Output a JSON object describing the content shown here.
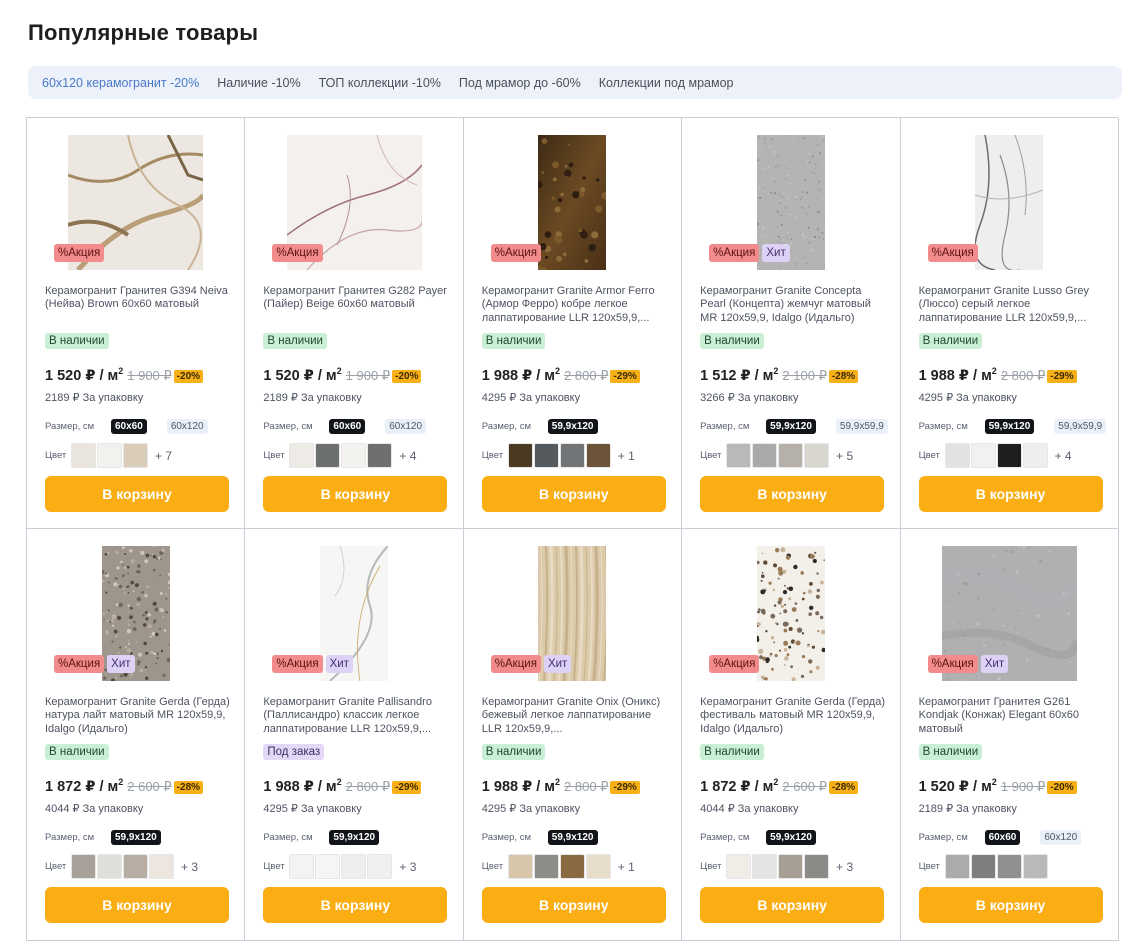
{
  "page": {
    "title": "Популярные товары"
  },
  "filters": [
    {
      "label": "60х120 керамогранит -20%",
      "active": true
    },
    {
      "label": "Наличие -10%",
      "active": false
    },
    {
      "label": "ТОП коллекции -10%",
      "active": false
    },
    {
      "label": "Под мрамор до -60%",
      "active": false
    },
    {
      "label": "Коллекции под мрамор",
      "active": false
    }
  ],
  "labels": {
    "size": "Размер, см",
    "color": "Цвет",
    "cart": "В корзину",
    "sale": "%Акция",
    "hit": "Хит",
    "unit": " ₽ / м",
    "unit_sup": "2"
  },
  "products": [
    {
      "name": "Керамогранит Гранитея G394 Neiva (Нейва) Brown 60x60 матовый",
      "badges": [
        "sale"
      ],
      "availability": "В наличии",
      "availability_type": "in",
      "price": "1 520",
      "old_price": "1 900 ₽",
      "discount": "-20%",
      "pack": "2189 ₽ За упаковку",
      "sizes": [
        "60x60",
        "60x120"
      ],
      "colors": [
        "#e9e4dc",
        "#f2f1ee",
        "#d9cdb8"
      ],
      "more": "+ 7",
      "tile": "marble-brown",
      "shape": "square"
    },
    {
      "name": "Керамогранит Гранитея G282 Payer (Пайер) Beige 60x60 матовый",
      "badges": [
        "sale"
      ],
      "availability": "В наличии",
      "availability_type": "in",
      "price": "1 520",
      "old_price": "1 900 ₽",
      "discount": "-20%",
      "pack": "2189 ₽ За упаковку",
      "sizes": [
        "60x60",
        "60x120"
      ],
      "colors": [
        "#eeeae5",
        "#6b6f6d",
        "#f4f2ef",
        "#6d706f"
      ],
      "more": "+ 4",
      "tile": "marble-beige",
      "shape": "square"
    },
    {
      "name": "Керамогранит Granite Armor Ferro (Армор Ферро) кобре легкое лаппатирование LLR 120x59,9,...",
      "badges": [
        "sale"
      ],
      "availability": "В наличии",
      "availability_type": "in",
      "price": "1 988",
      "old_price": "2 800 ₽",
      "discount": "-29%",
      "pack": "4295 ₽ За упаковку",
      "sizes": [
        "59,9x120"
      ],
      "colors": [
        "#4b3a22",
        "#555a5e",
        "#727578",
        "#6b5438"
      ],
      "more": "+ 1",
      "tile": "rust",
      "shape": "tall"
    },
    {
      "name": "Керамогранит Granite Concepta Pearl (Концепта) жемчуг матовый MR 120x59,9, Idalgo (Идальго)",
      "badges": [
        "sale",
        "hit"
      ],
      "availability": "В наличии",
      "availability_type": "in",
      "price": "1 512",
      "old_price": "2 100 ₽",
      "discount": "-28%",
      "pack": "3266 ₽ За упаковку",
      "sizes": [
        "59,9x120",
        "59,9x59,9"
      ],
      "colors": [
        "#b9b9b7",
        "#a9a9a7",
        "#b5b1aa",
        "#d9d6cf"
      ],
      "more": "+ 5",
      "tile": "concrete",
      "shape": "tall"
    },
    {
      "name": "Керамогранит Granite Lusso Grey (Люссо) серый легкое лаппатирование LLR 120x59,9,...",
      "badges": [
        "sale"
      ],
      "availability": "В наличии",
      "availability_type": "in",
      "price": "1 988",
      "old_price": "2 800 ₽",
      "discount": "-29%",
      "pack": "4295 ₽ За упаковку",
      "sizes": [
        "59,9x120",
        "59,9x59,9"
      ],
      "colors": [
        "#e2e2e0",
        "#f1f1f0",
        "#1d1f1e",
        "#efeeed"
      ],
      "more": "+ 4",
      "tile": "marble-grey",
      "shape": "tall"
    },
    {
      "name": "Керамогранит Granite Gerda (Герда) натура лайт матовый MR 120x59,9, Idalgo (Идальго)",
      "badges": [
        "sale",
        "hit"
      ],
      "availability": "В наличии",
      "availability_type": "in",
      "price": "1 872",
      "old_price": "2 600 ₽",
      "discount": "-28%",
      "pack": "4044 ₽ За упаковку",
      "sizes": [
        "59,9x120"
      ],
      "colors": [
        "#a8a199",
        "#e0dedb",
        "#b8ada2",
        "#ece6df"
      ],
      "more": "+ 3",
      "tile": "terrazzo-grey",
      "shape": "tall"
    },
    {
      "name": "Керамогранит Granite Pallisandro (Паллисандро) классик легкое лаппатирование LLR 120x59,9,...",
      "badges": [
        "sale",
        "hit"
      ],
      "availability": "Под заказ",
      "availability_type": "order",
      "price": "1 988",
      "old_price": "2 800 ₽",
      "discount": "-29%",
      "pack": "4295 ₽ За упаковку",
      "sizes": [
        "59,9x120"
      ],
      "colors": [
        "#f3f3f2",
        "#f5f5f4",
        "#eeeeed",
        "#f1f0ef"
      ],
      "more": "+ 3",
      "tile": "marble-white",
      "shape": "tall"
    },
    {
      "name": "Керамогранит Granite Onix (Оникс) бежевый легкое лаппатирование LLR 120x59,9,...",
      "badges": [
        "sale",
        "hit"
      ],
      "availability": "В наличии",
      "availability_type": "in",
      "price": "1 988",
      "old_price": "2 800 ₽",
      "discount": "-29%",
      "pack": "4295 ₽ За упаковку",
      "sizes": [
        "59,9x120"
      ],
      "colors": [
        "#d7c6a8",
        "#8d8c88",
        "#8a6a40",
        "#e8dccb"
      ],
      "more": "+ 1",
      "tile": "onyx",
      "shape": "tall"
    },
    {
      "name": "Керамогранит Granite Gerda (Герда) фестиваль матовый MR 120x59,9, Idalgo (Идальго)",
      "badges": [
        "sale"
      ],
      "availability": "В наличии",
      "availability_type": "in",
      "price": "1 872",
      "old_price": "2 600 ₽",
      "discount": "-28%",
      "pack": "4044 ₽ За упаковку",
      "sizes": [
        "59,9x120"
      ],
      "colors": [
        "#f1ede6",
        "#e4e4e3",
        "#a79e94",
        "#8b8a87"
      ],
      "more": "+ 3",
      "tile": "terrazzo-festival",
      "shape": "tall"
    },
    {
      "name": "Керамогранит Гранитея G261 Kondjak (Конжак) Elegant 60x60 матовый",
      "badges": [
        "sale",
        "hit"
      ],
      "availability": "В наличии",
      "availability_type": "in",
      "price": "1 520",
      "old_price": "1 900 ₽",
      "discount": "-20%",
      "pack": "2189 ₽ За упаковку",
      "sizes": [
        "60x60",
        "60x120"
      ],
      "colors": [
        "#a9abad",
        "#7c7e80",
        "#8e9092",
        "#b7b9ba"
      ],
      "more": "",
      "tile": "stone-grey",
      "shape": "square"
    }
  ]
}
